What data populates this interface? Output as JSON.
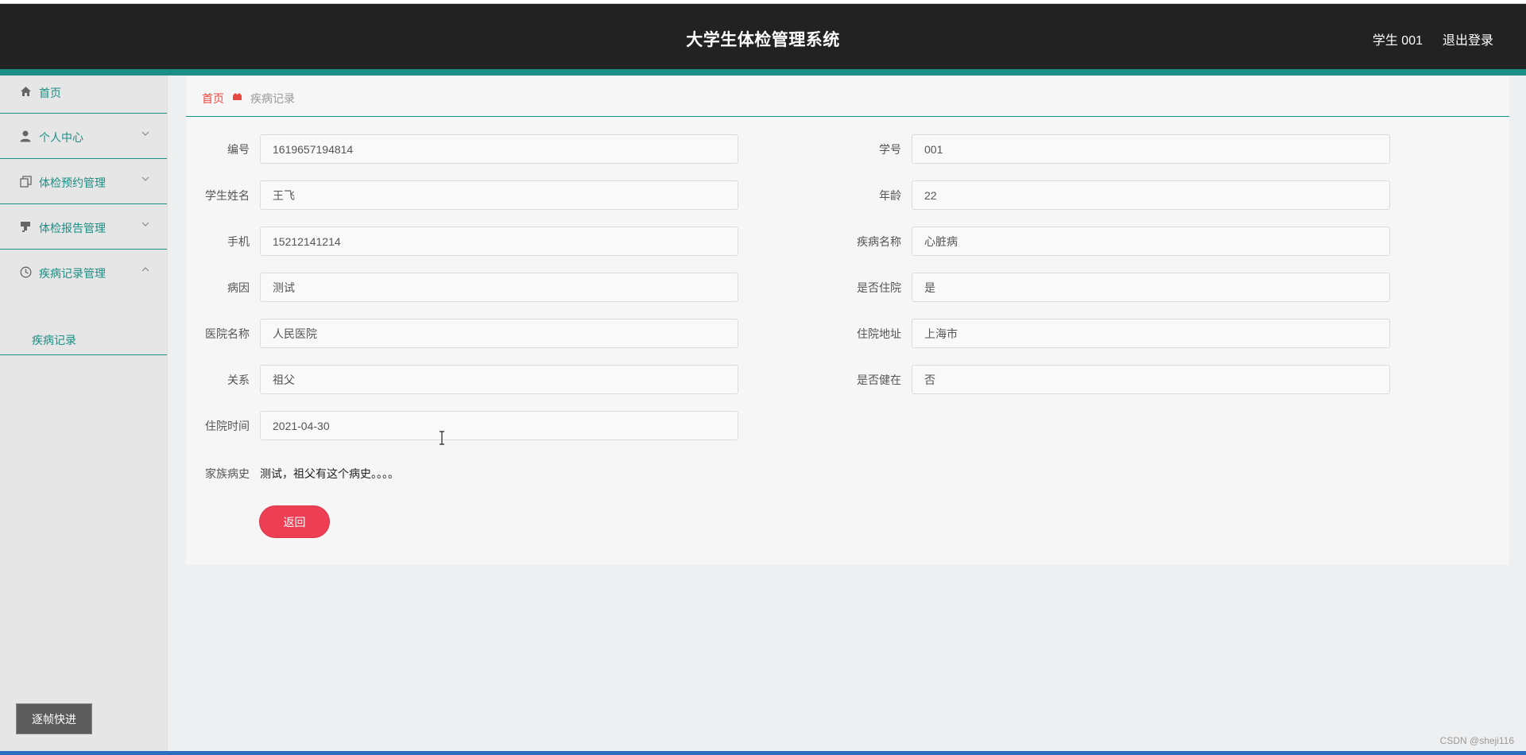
{
  "header": {
    "title": "大学生体检管理系统",
    "user": "学生 001",
    "logout": "退出登录"
  },
  "sidebar": {
    "items": [
      {
        "label": "首页",
        "icon": "home-icon"
      },
      {
        "label": "个人中心",
        "icon": "user-icon"
      },
      {
        "label": "体检预约管理",
        "icon": "copy-icon"
      },
      {
        "label": "体检报告管理",
        "icon": "stamp-icon"
      },
      {
        "label": "疾病记录管理",
        "icon": "clock-icon"
      }
    ],
    "submenu": {
      "label": "疾病记录"
    },
    "step_button": "逐帧快进"
  },
  "breadcrumb": {
    "home": "首页",
    "current": "疾病记录"
  },
  "form": {
    "left": [
      {
        "label": "编号",
        "value": "1619657194814"
      },
      {
        "label": "学生姓名",
        "value": "王飞"
      },
      {
        "label": "手机",
        "value": "15212141214"
      },
      {
        "label": "病因",
        "value": "测试"
      },
      {
        "label": "医院名称",
        "value": "人民医院"
      },
      {
        "label": "关系",
        "value": "祖父"
      },
      {
        "label": "住院时间",
        "value": "2021-04-30"
      }
    ],
    "right": [
      {
        "label": "学号",
        "value": "001"
      },
      {
        "label": "年龄",
        "value": "22"
      },
      {
        "label": "疾病名称",
        "value": "心脏病"
      },
      {
        "label": "是否住院",
        "value": "是"
      },
      {
        "label": "住院地址",
        "value": "上海市"
      },
      {
        "label": "是否健在",
        "value": "否"
      }
    ],
    "history": {
      "label": "家族病史",
      "value": "测试，祖父有这个病史。。。。"
    },
    "back_button": "返回"
  },
  "watermark": "CSDN @sheji116",
  "colors": {
    "accent": "#1b8f85",
    "header_bg": "#222222",
    "danger": "#ee3e53",
    "breadcrumb_home": "#e8473f"
  }
}
